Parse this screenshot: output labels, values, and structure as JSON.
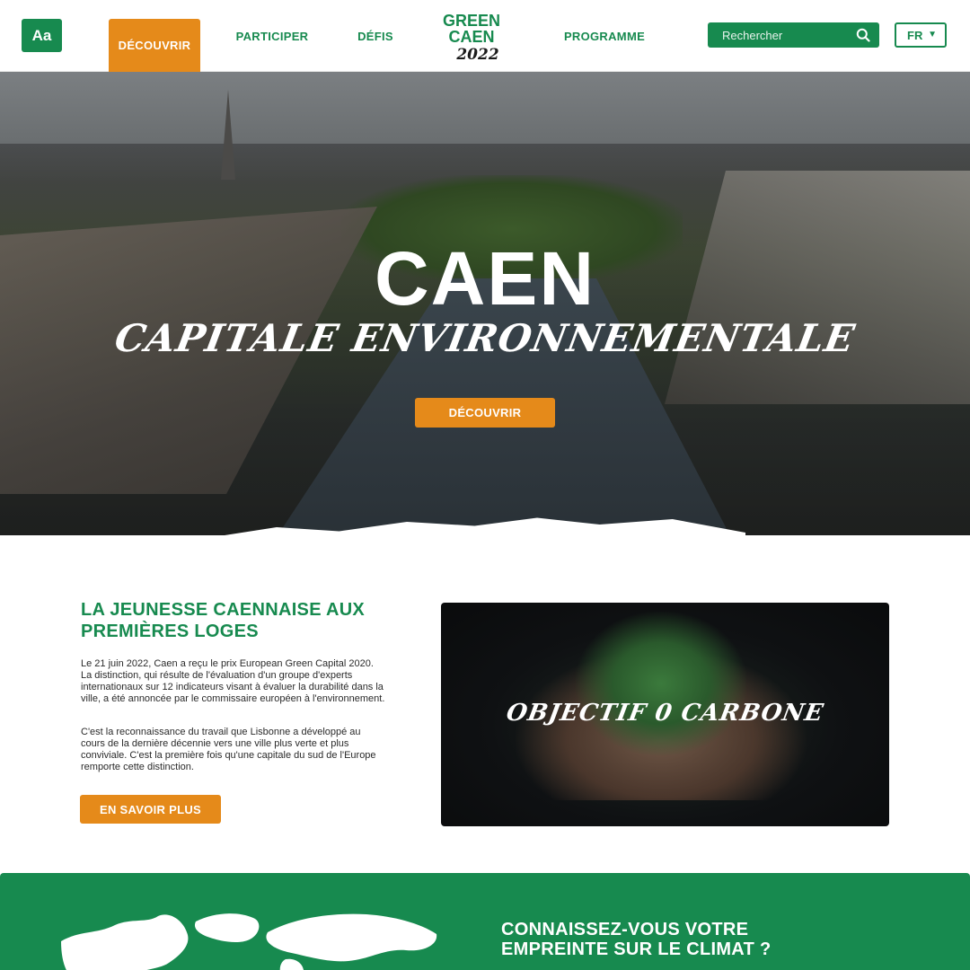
{
  "header": {
    "font_toggle_label": "Aa",
    "nav": [
      {
        "label": "DÉCOUVRIR",
        "active": true
      },
      {
        "label": "PARTICIPER",
        "active": false
      },
      {
        "label": "DÉFIS",
        "active": false
      },
      {
        "label": "PROGRAMME",
        "active": false
      }
    ],
    "logo": {
      "line1": "GREEN",
      "line2": "CAEN",
      "line3": "2022"
    },
    "search": {
      "placeholder": "Rechercher",
      "icon": "search-icon"
    },
    "language": {
      "selected": "FR",
      "icon": "chevron-down-icon"
    }
  },
  "hero": {
    "title": "CAEN",
    "subtitle": "Capitale environnementale",
    "cta_label": "DÉCOUVRIR"
  },
  "intro": {
    "title": "LA JEUNESSE CAENNAISE AUX PREMIÈRES LOGES",
    "paragraph1": "Le 21 juin 2022, Caen a reçu le prix European Green Capital 2020. La distinction, qui résulte de l'évaluation d'un groupe d'experts internationaux sur 12 indicateurs visant à évaluer la durabilité dans la ville, a été annoncée par le commissaire européen à l'environnement.",
    "paragraph2": "C'est la reconnaissance du travail que Lisbonne a développé au cours de la dernière décennie vers une ville plus verte et plus conviviale. C'est la première fois qu'une capitale du sud de l'Europe remporte cette distinction.",
    "cta_label": "EN SAVOIR PLUS"
  },
  "promo": {
    "text": "Objectif 0 carbone"
  },
  "climate": {
    "title": "CONNAISSEZ-VOUS VOTRE EMPREINTE SUR LE CLIMAT ?",
    "icon": "world-map-icon"
  },
  "colors": {
    "brand_green": "#178a4f",
    "accent_orange": "#e58a1a"
  }
}
